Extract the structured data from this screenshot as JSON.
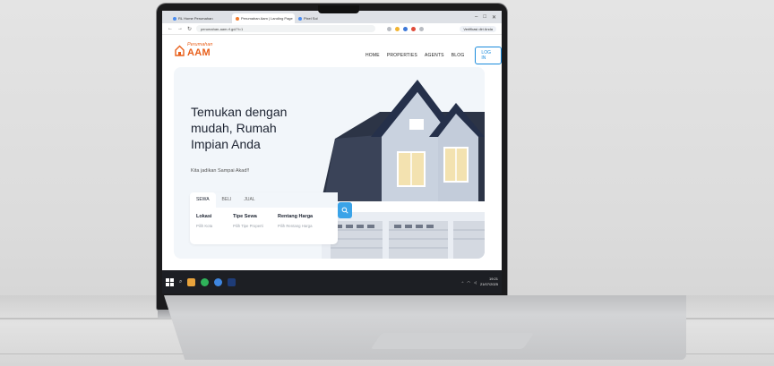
{
  "browser": {
    "tabs": [
      {
        "title": "RL Home Perumahan",
        "active": false
      },
      {
        "title": "Perumahan Aam | Landing Page",
        "active": true
      },
      {
        "title": "Pixel Sol",
        "active": false
      }
    ],
    "url": "perumahan-aam.rf.gd/?i=1",
    "profile_label": "Verifikasi diri Anda"
  },
  "site": {
    "logo": {
      "line1": "Perumahan",
      "line2": "AAM"
    },
    "nav": [
      "HOME",
      "PROPERTIES",
      "AGENTS",
      "BLOG"
    ],
    "login_label": "LOG IN",
    "hero": {
      "title": "Temukan dengan mudah, Rumah Impian Anda",
      "subtitle": "Kita jadikan Sampai Akad!!"
    },
    "search": {
      "tabs": [
        "SEWA",
        "BELI",
        "JUAL"
      ],
      "fields": [
        {
          "label": "Lokasi",
          "placeholder": "Pilih Kota"
        },
        {
          "label": "Tipe Sewa",
          "placeholder": "Pilih Tipe Properti"
        },
        {
          "label": "Rentang Harga",
          "placeholder": "Pilih Rentang Harga"
        }
      ]
    }
  },
  "taskbar": {
    "time": "19:21",
    "date": "21/07/2025"
  },
  "colors": {
    "brand": "#e8601c",
    "accent": "#3aa3e8"
  }
}
